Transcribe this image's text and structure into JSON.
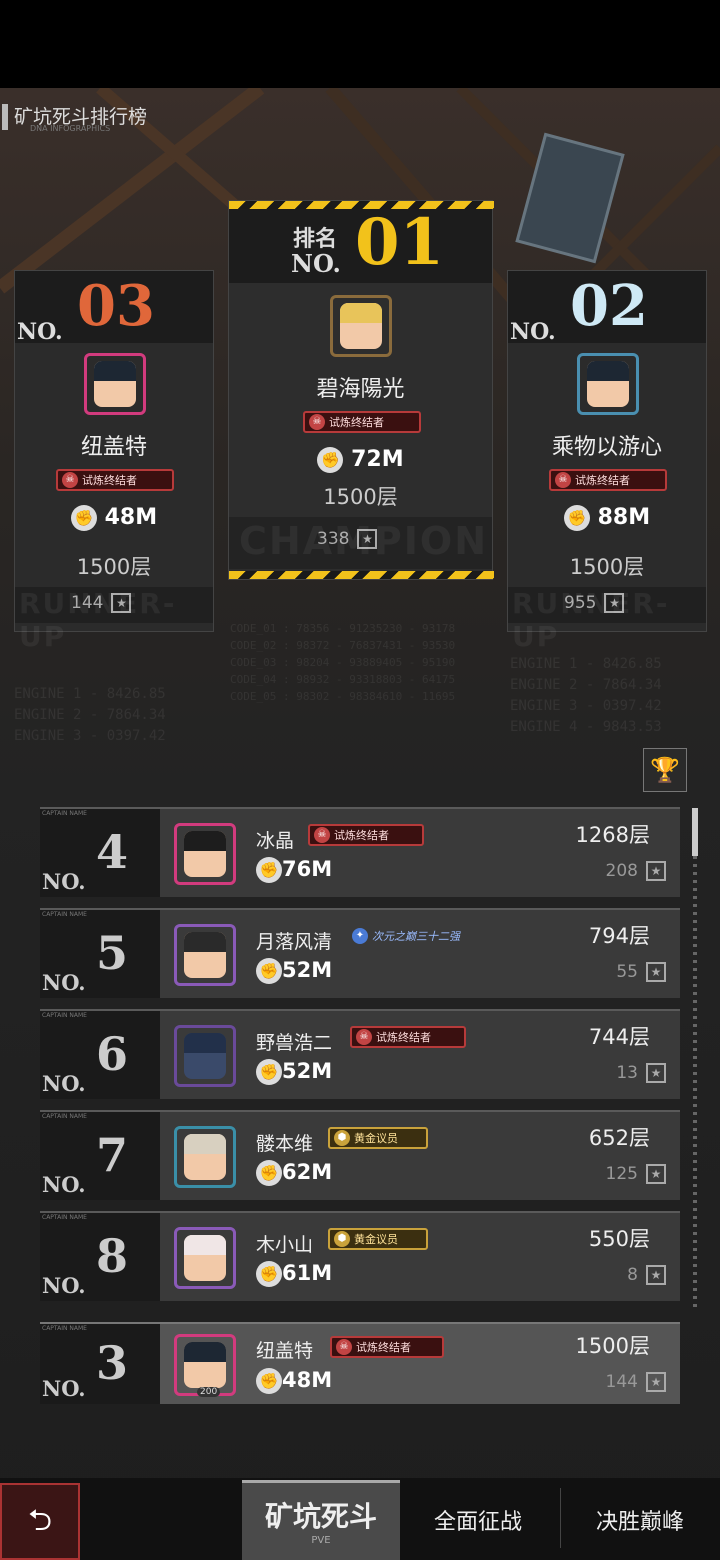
{
  "page": {
    "title": "矿坑死斗排行榜",
    "subtitle": "DNA INFOGRAPHICS"
  },
  "podium": {
    "first": {
      "rank_label": "排名",
      "no": "NO.",
      "rank": "01",
      "name": "碧海陽光",
      "badge": "试炼终结者",
      "power": "72M",
      "floor": "1500层",
      "stars": "338",
      "tag": "CHAMPION"
    },
    "second": {
      "no": "NO.",
      "rank": "02",
      "name": "乘物以游心",
      "badge": "试炼终结者",
      "power": "88M",
      "floor": "1500层",
      "stars": "955",
      "tag": "RUNNER-UP"
    },
    "third": {
      "no": "NO.",
      "rank": "03",
      "name": "纽盖特",
      "badge": "试炼终结者",
      "power": "48M",
      "floor": "1500层",
      "stars": "144",
      "tag": "RUNNER-UP"
    }
  },
  "rows": [
    {
      "no": "NO.",
      "rank": "4",
      "name": "冰晶",
      "badge": "试炼终结者",
      "power": "76M",
      "floor": "1268层",
      "stars": "208"
    },
    {
      "no": "NO.",
      "rank": "5",
      "name": "月落风清",
      "badge": "次元之巅三十二强",
      "power": "52M",
      "floor": "794层",
      "stars": "55"
    },
    {
      "no": "NO.",
      "rank": "6",
      "name": "野兽浩二",
      "badge": "试炼终结者",
      "power": "52M",
      "floor": "744层",
      "stars": "13"
    },
    {
      "no": "NO.",
      "rank": "7",
      "name": "髅本维",
      "badge": "黄金议员",
      "power": "62M",
      "floor": "652层",
      "stars": "125"
    },
    {
      "no": "NO.",
      "rank": "8",
      "name": "木小山",
      "badge": "黄金议员",
      "power": "61M",
      "floor": "550层",
      "stars": "8"
    }
  ],
  "my_rank": {
    "no": "NO.",
    "rank": "3",
    "name": "纽盖特",
    "badge": "试炼终结者",
    "power": "48M",
    "floor": "1500层",
    "stars": "144",
    "level": "200"
  },
  "nav": {
    "back": "⮌",
    "tabs": [
      {
        "label": "矿坑死斗",
        "sub": "PVE"
      },
      {
        "label": "全面征战"
      },
      {
        "label": "决胜巅峰"
      }
    ]
  },
  "colors": {
    "gold": "#f2c21b",
    "bronze": "#e0673a",
    "silver": "#cfe9f5",
    "badge_red": "#b73a3a"
  }
}
